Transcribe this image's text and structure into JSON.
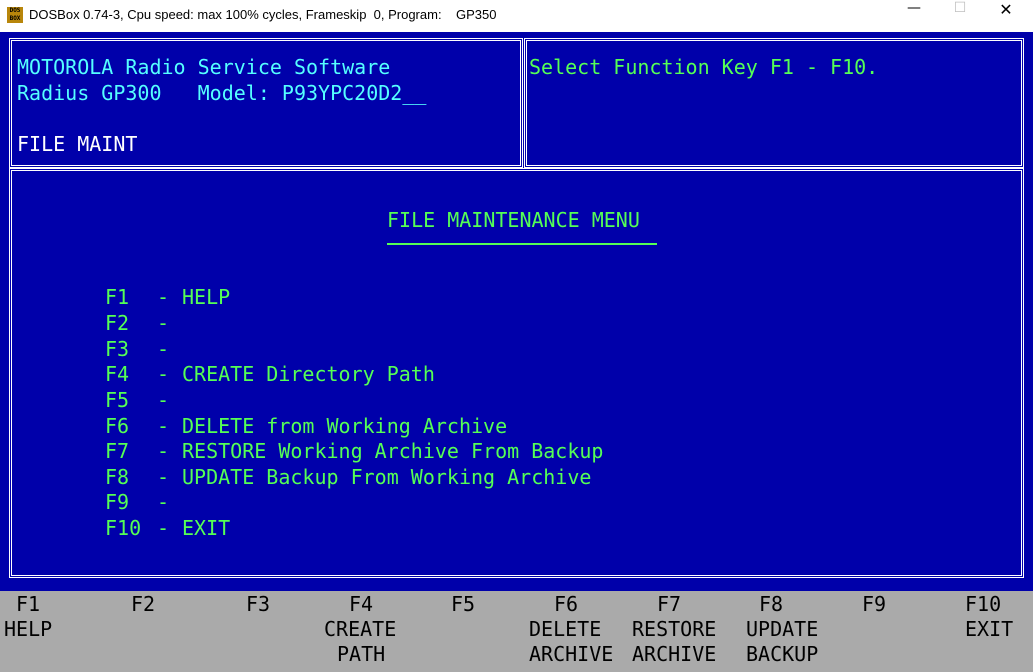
{
  "window": {
    "title": "DOSBox 0.74-3, Cpu speed: max 100% cycles, Frameskip  0, Program:    GP350",
    "icon_label": "DOS BOX",
    "controls": {
      "minimize": "—",
      "maximize": "☐",
      "close": "✕"
    }
  },
  "header": {
    "line1": "MOTOROLA Radio Service Software",
    "line2": "Radius GP300   Model: P93YPC20D2__",
    "mode": "FILE MAINT"
  },
  "prompt": {
    "text": "Select Function Key F1 - F10."
  },
  "menu": {
    "title": "FILE MAINTENANCE MENU",
    "items": [
      {
        "key": "F1",
        "label": "HELP"
      },
      {
        "key": "F2",
        "label": ""
      },
      {
        "key": "F3",
        "label": ""
      },
      {
        "key": "F4",
        "label": "CREATE Directory Path"
      },
      {
        "key": "F5",
        "label": ""
      },
      {
        "key": "F6",
        "label": "DELETE from Working Archive"
      },
      {
        "key": "F7",
        "label": "RESTORE Working Archive From Backup"
      },
      {
        "key": "F8",
        "label": "UPDATE Backup From Working Archive"
      },
      {
        "key": "F9",
        "label": ""
      },
      {
        "key": "F10",
        "label": "EXIT"
      }
    ]
  },
  "function_bar": [
    {
      "key": "F1",
      "line1": "HELP",
      "line2": ""
    },
    {
      "key": "F2",
      "line1": "",
      "line2": ""
    },
    {
      "key": "F3",
      "line1": "",
      "line2": ""
    },
    {
      "key": "F4",
      "line1": "CREATE",
      "line2": "PATH"
    },
    {
      "key": "F5",
      "line1": "",
      "line2": ""
    },
    {
      "key": "F6",
      "line1": "DELETE",
      "line2": "ARCHIVE"
    },
    {
      "key": "F7",
      "line1": "RESTORE",
      "line2": "ARCHIVE"
    },
    {
      "key": "F8",
      "line1": "UPDATE",
      "line2": "BACKUP"
    },
    {
      "key": "F9",
      "line1": "",
      "line2": ""
    },
    {
      "key": "F10",
      "line1": "EXIT",
      "line2": ""
    }
  ],
  "colors": {
    "screen_bg": "#0000aa",
    "header_text": "#55ffff",
    "mode_text": "#ffffff",
    "menu_text": "#55ff55",
    "function_bar_bg": "#aaaaaa"
  }
}
